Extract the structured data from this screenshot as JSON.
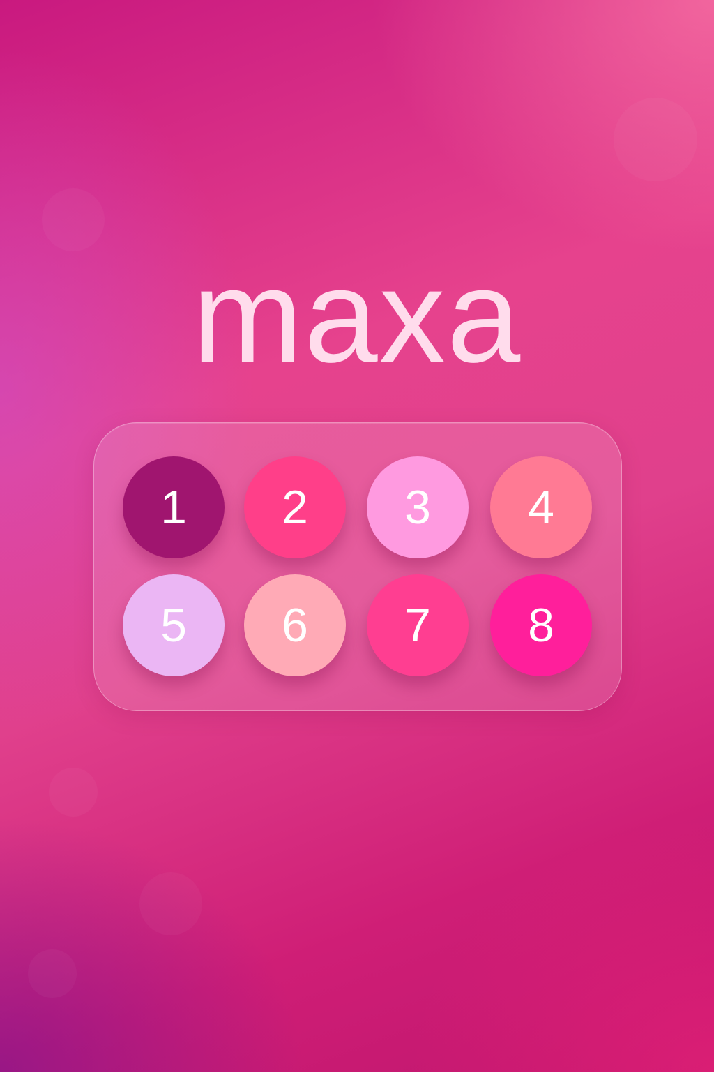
{
  "app": {
    "logo_text": "maxa"
  },
  "keypad": {
    "keys": [
      {
        "label": "1",
        "color": "#a0156f"
      },
      {
        "label": "2",
        "color": "#ff3f89"
      },
      {
        "label": "3",
        "color": "#ff9ae0"
      },
      {
        "label": "4",
        "color": "#ff7a94"
      },
      {
        "label": "5",
        "color": "#ebb6f4"
      },
      {
        "label": "6",
        "color": "#ffaab6"
      },
      {
        "label": "7",
        "color": "#ff3e91"
      },
      {
        "label": "8",
        "color": "#ff1f9b"
      }
    ]
  },
  "theme": {
    "logo_color": "#ffdcec",
    "background_top": "#c9197f",
    "background_bottom": "#c0166e"
  }
}
